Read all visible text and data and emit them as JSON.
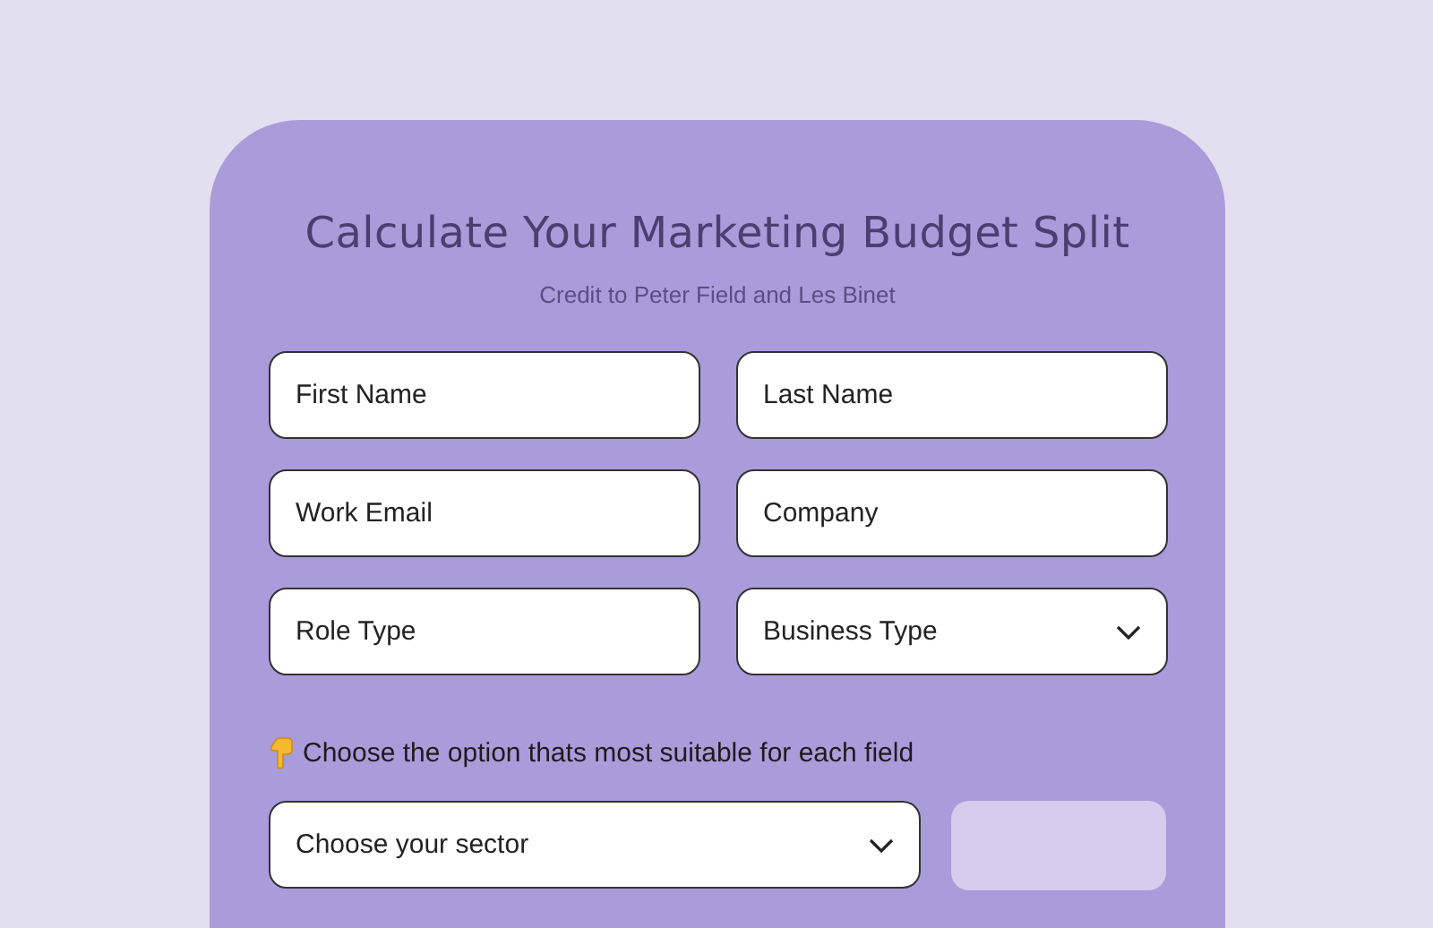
{
  "form": {
    "title": "Calculate Your Marketing Budget Split",
    "subtitle": "Credit to Peter Field and Les Binet",
    "fields": [
      {
        "kind": "text",
        "placeholder": "First Name"
      },
      {
        "kind": "text",
        "placeholder": "Last Name"
      },
      {
        "kind": "text",
        "placeholder": "Work Email"
      },
      {
        "kind": "text",
        "placeholder": "Company"
      },
      {
        "kind": "text",
        "placeholder": "Role Type"
      },
      {
        "kind": "select",
        "placeholder": "Business Type"
      }
    ],
    "instruction": "Choose the option thats most suitable for each field",
    "sector": {
      "kind": "select",
      "placeholder": "Choose your sector"
    },
    "action_button": {
      "disabled": true
    }
  }
}
